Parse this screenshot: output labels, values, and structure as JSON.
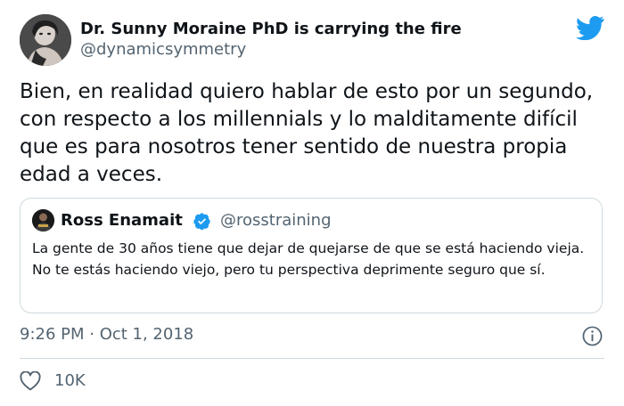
{
  "author": {
    "name": "Dr. Sunny Moraine PhD is carrying the fire",
    "handle": "@dynamicsymmetry",
    "avatar_icon": "profile-photo"
  },
  "brand": {
    "icon": "twitter-bird-icon",
    "color": "#1d9bf0"
  },
  "tweet": {
    "text": "Bien, en realidad quiero hablar de esto por un segundo, con respecto a los millennials y lo malditamente difícil que es para nosotros tener sentido de nuestra propia edad a veces.",
    "timestamp": "9:26 PM · Oct 1, 2018"
  },
  "quoted_tweet": {
    "name": "Ross Enamait",
    "verified": true,
    "handle": "@rosstraining",
    "text": "La gente de 30 años tiene que dejar de quejarse de que se está haciendo vieja. No te estás haciendo viejo, pero tu perspectiva deprimente seguro que sí."
  },
  "actions": {
    "like_count": "10K",
    "like_icon": "heart-icon",
    "info_icon": "info-icon"
  },
  "colors": {
    "text": "#0f1419",
    "secondary": "#536471",
    "border": "#cfd9de",
    "verified": "#1d9bf0"
  }
}
